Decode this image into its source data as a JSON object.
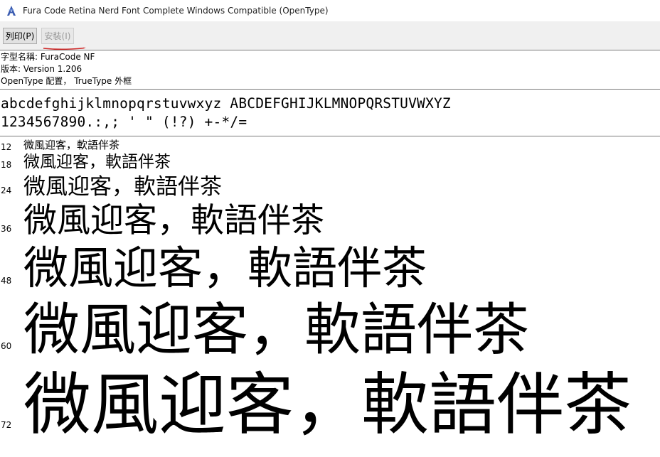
{
  "window": {
    "title": "Fura Code Retina Nerd Font Complete Windows Compatible (OpenType)",
    "icon": "font-viewer-a-icon"
  },
  "toolbar": {
    "print_label": "列印(P)",
    "install_label": "安裝(I)",
    "underline_color": "#d12a2a"
  },
  "info": {
    "font_name": "字型名稱: FuraCode NF",
    "version": "版本: Version 1.206",
    "outline": "OpenType 配置， TrueType 外框"
  },
  "sample": {
    "line1": "abcdefghijklmnopqrstuvwxyz ABCDEFGHIJKLMNOPQRSTUVWXYZ",
    "line2": "1234567890.:,; ' \" (!?) +-*/="
  },
  "preview_text": "微風迎客，軟語伴茶",
  "sizes": [
    {
      "label": "12"
    },
    {
      "label": "18"
    },
    {
      "label": "24"
    },
    {
      "label": "36"
    },
    {
      "label": "48"
    },
    {
      "label": "60"
    },
    {
      "label": "72"
    }
  ]
}
